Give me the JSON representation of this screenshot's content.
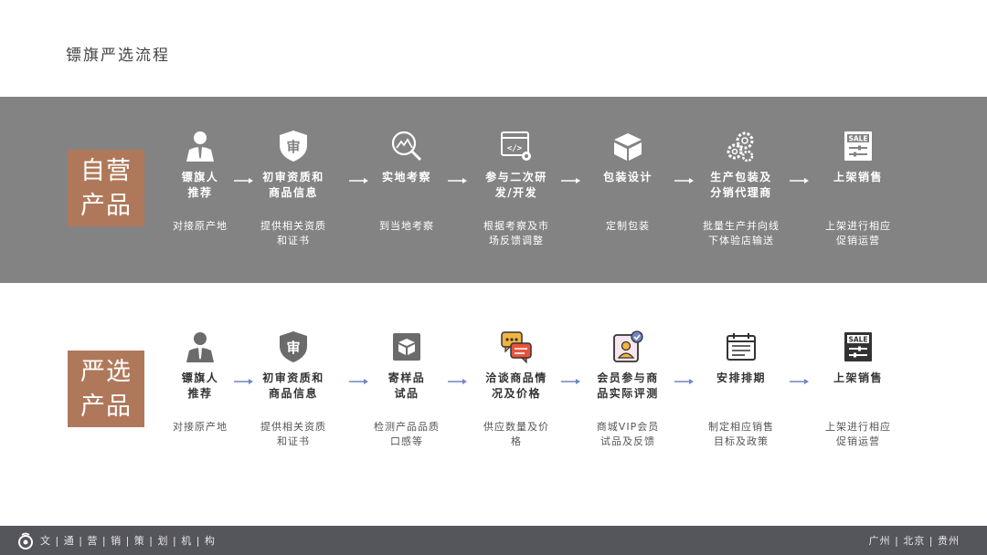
{
  "page": {
    "title": "镖旗严选流程"
  },
  "self_band": {
    "tag_label": "自营产品",
    "steps": [
      {
        "icon": "person-icon",
        "label": "镖旗人\n推荐",
        "desc": "对接原产地"
      },
      {
        "icon": "shield-icon",
        "label": "初审资质和\n商品信息",
        "desc": "提供相关资质\n和证书",
        "icon_text": "审"
      },
      {
        "icon": "magnifier-mountain-icon",
        "label": "实地考察",
        "desc": "到当地考察"
      },
      {
        "icon": "code-window-icon",
        "label": "参与二次研\n发/开发",
        "desc": "根据考察及市\n场反馈调整"
      },
      {
        "icon": "box-icon",
        "label": "包装设计",
        "desc": "定制包装"
      },
      {
        "icon": "gears-icon",
        "label": "生产包装及\n分销代理商",
        "desc": "批量生产并向线\n下体验店输送"
      },
      {
        "icon": "sale-board-icon",
        "label": "上架销售",
        "desc": "上架进行相应\n促销运营",
        "icon_text": "SALE"
      }
    ]
  },
  "strict_band": {
    "tag_label": "严选产品",
    "steps": [
      {
        "icon": "person-icon",
        "label": "镖旗人\n推荐",
        "desc": "对接原产地"
      },
      {
        "icon": "shield-icon",
        "label": "初审资质和\n商品信息",
        "desc": "提供相关资质\n和证书",
        "icon_text": "审"
      },
      {
        "icon": "sample-box-icon",
        "label": "寄样品\n试品",
        "desc": "检测产品品质\n口感等"
      },
      {
        "icon": "chat-bubbles-icon",
        "label": "洽谈商品情\n况及价格",
        "desc": "供应数量及价\n格"
      },
      {
        "icon": "member-badge-icon",
        "label": "会员参与商\n品实际评测",
        "desc": "商城VIP会员\n试品及反馈"
      },
      {
        "icon": "calendar-icon",
        "label": "安排排期",
        "desc": "制定相应销售\n目标及政策"
      },
      {
        "icon": "sale-board-icon",
        "label": "上架销售",
        "desc": "上架进行相应\n促销运营",
        "icon_text": "SALE"
      }
    ]
  },
  "footer": {
    "brand": "文 | 通 | 营 | 销 | 策 | 划 | 机 | 构",
    "cities": "广州  |  北京  |  贵州"
  },
  "colors": {
    "self_band_bg": "#838383",
    "tag_bg": "#b0785a",
    "footer_bg": "#55555c",
    "arrow_light": "#ffffff",
    "arrow_blue": "#6f86c4"
  }
}
